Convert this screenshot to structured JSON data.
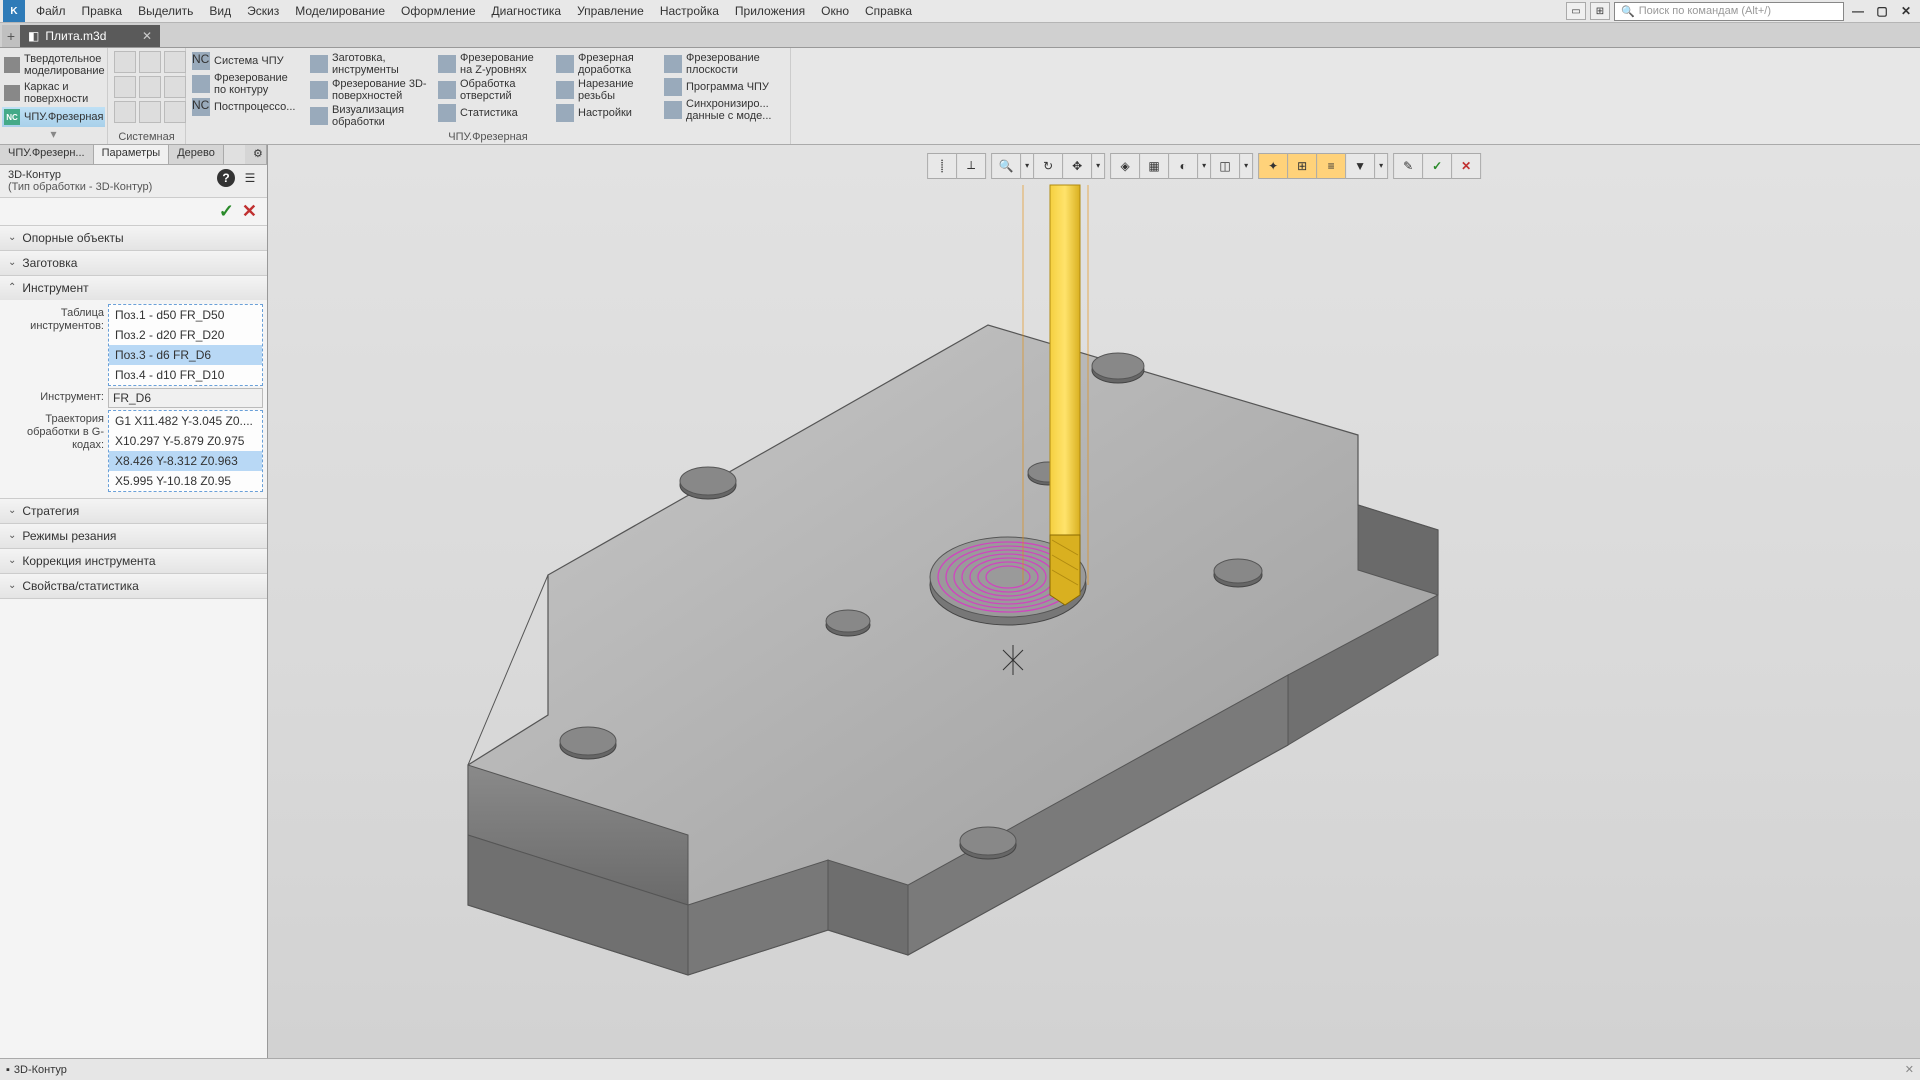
{
  "menubar": {
    "items": [
      "Файл",
      "Правка",
      "Выделить",
      "Вид",
      "Эскиз",
      "Моделирование",
      "Оформление",
      "Диагностика",
      "Управление",
      "Настройка",
      "Приложения",
      "Окно",
      "Справка"
    ],
    "search_placeholder": "Поиск по командам (Alt+/)"
  },
  "doc_tab": {
    "title": "Плита.m3d"
  },
  "ribbon_left": {
    "items": [
      {
        "label": "Твердотельное моделирование"
      },
      {
        "label": "Каркас и поверхности"
      },
      {
        "label": "ЧПУ.Фрезерная",
        "active": true
      }
    ]
  },
  "ribbon": {
    "groups": [
      {
        "label": "Системная",
        "rows": []
      },
      {
        "label": "ЧПУ.Фрезерная",
        "cols": [
          [
            {
              "text": "Система ЧПУ"
            },
            {
              "text": "Фрезерование по контуру"
            },
            {
              "text": "Постпроцессо..."
            }
          ],
          [
            {
              "text": "Заготовка, инструменты"
            },
            {
              "text": "Фрезерование 3D-поверхностей"
            },
            {
              "text": "Визуализация обработки"
            }
          ],
          [
            {
              "text": "Фрезерование на Z-уровнях"
            },
            {
              "text": "Обработка отверстий"
            },
            {
              "text": "Статистика"
            }
          ],
          [
            {
              "text": "Фрезерная доработка"
            },
            {
              "text": "Нарезание резьбы"
            },
            {
              "text": "Настройки"
            }
          ],
          [
            {
              "text": "Фрезерование плоскости"
            },
            {
              "text": "Программа ЧПУ"
            },
            {
              "text": "Синхронизиро... данные с моде..."
            }
          ]
        ]
      }
    ]
  },
  "panel_tabs": [
    "ЧПУ.Фрезерн...",
    "Параметры",
    "Дерево"
  ],
  "params": {
    "title": "3D-Контур",
    "subtitle": "(Тип обработки - 3D-Контур)",
    "sections": {
      "ref": "Опорные объекты",
      "stock": "Заготовка",
      "tool": "Инструмент",
      "strategy": "Стратегия",
      "cutting": "Режимы резания",
      "correction": "Коррекция инструмента",
      "stats": "Свойства/статистика"
    },
    "tool_table_label": "Таблица инструментов:",
    "tool_field_label": "Инструмент:",
    "traj_label": "Траектория обработки в G-кодах:",
    "tool_list": [
      "Поз.1 - d50 FR_D50",
      "Поз.2 - d20 FR_D20",
      "Поз.3 - d6 FR_D6",
      "Поз.4 - d10 FR_D10"
    ],
    "tool_selected_index": 2,
    "tool_value": "FR_D6",
    "gcode": [
      "G1 X11.482 Y-3.045 Z0....",
      "X10.297 Y-5.879 Z0.975",
      "X8.426 Y-8.312 Z0.963",
      "X5.995 Y-10.18 Z0.95"
    ],
    "gcode_selected_index": 2
  },
  "statusbar": {
    "text": "3D-Контур"
  }
}
